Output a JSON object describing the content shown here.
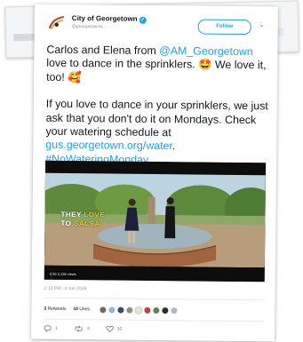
{
  "background_card": {
    "strip_text": "··· ··· ··· ··· ···"
  },
  "tweet": {
    "display_name": "City of Georgetown",
    "handle": "@georgetowntx",
    "follow_label": "Follow",
    "text": {
      "p1_a": "Carlos and Elena from ",
      "p1_mention": "@AM_Georgetown",
      "p1_b": " love to dance in the sprinklers. 🤩 We love it, too! 🥰",
      "p2_a": "If you love to dance in your sprinklers, we just ask that you don't do it on Mondays. Check your watering schedule at ",
      "p2_link": "gus.georgetown.org/water",
      "p2_b": ".",
      "hashtag": "#NoWateringMonday"
    },
    "video": {
      "overlay_line1_a": "THEY ",
      "overlay_line1_b": "LOVE",
      "overlay_line2_a": "TO ",
      "overlay_line2_b": "SALSA",
      "stats": "0:26   3,136 views"
    },
    "timestamp": "2:13 PM - 4 Jun 2019",
    "retweets_count": "3",
    "retweets_label": "Retweets",
    "likes_count": "10",
    "likes_label": "Likes",
    "reply_count": "1",
    "retweet_action_count": "3",
    "like_action_count": "10"
  },
  "colors": {
    "link": "#1da1f2",
    "text": "#14171a",
    "muted": "#8a949c",
    "brand_red": "#c8342b",
    "brand_gold": "#d4a017"
  },
  "icons": [
    "logo-icon",
    "verified-icon",
    "chevron-down-icon",
    "reply-icon",
    "retweet-icon",
    "like-icon",
    "play-icon"
  ]
}
